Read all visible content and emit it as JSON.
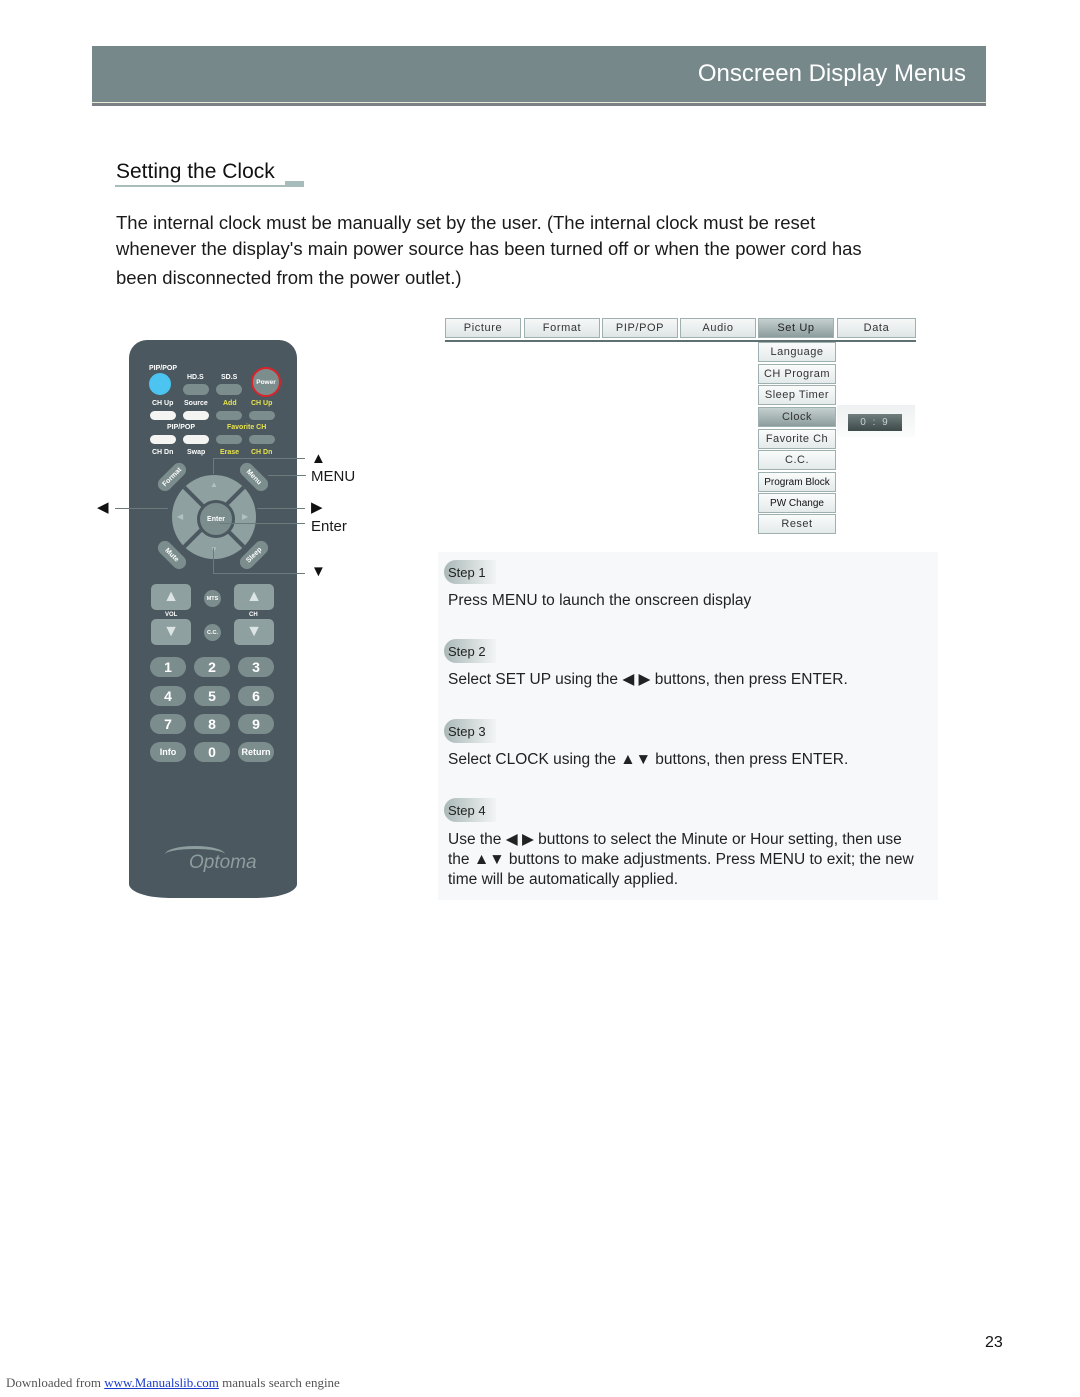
{
  "header": {
    "title": "Onscreen Display Menus"
  },
  "section": {
    "title": "Setting the Clock",
    "intro_lines": [
      "The internal clock must be manually set by the user. (The internal clock must be reset",
      "whenever the display's main power source has been turned off or when the power cord has",
      "been disconnected from the power outlet.)"
    ]
  },
  "remote": {
    "row1_labels": [
      "PIP/POP",
      "HD.S",
      "SD.S"
    ],
    "power_label": "Power",
    "row2_labels": [
      "CH Up",
      "Source",
      "Add",
      "CH Up"
    ],
    "row3_labels": [
      "PIP/POP",
      "Favorite CH"
    ],
    "row4_labels": [
      "CH Dn",
      "Swap",
      "Erase",
      "CH Dn"
    ],
    "diag_buttons": [
      "Format",
      "Menu",
      "Mute",
      "Sleep"
    ],
    "enter_label": "Enter",
    "mts_label": "MTS",
    "cc_label": "C.C.",
    "vol_label": "VOL",
    "ch_label": "CH",
    "keypad": [
      "1",
      "2",
      "3",
      "4",
      "5",
      "6",
      "7",
      "8",
      "9",
      "Info",
      "0",
      "Return"
    ],
    "brand": "Optoma",
    "icons": {
      "up": "▲",
      "down": "▼",
      "left": "◀",
      "right": "▶"
    }
  },
  "callouts": {
    "up_icon": "▲",
    "menu": "MENU",
    "left_icon": "◀",
    "right_icon": "▶",
    "enter": "Enter",
    "down_icon": "▼"
  },
  "osd": {
    "tabs": [
      "Picture",
      "Format",
      "PIP/POP",
      "Audio",
      "Set Up",
      "Data"
    ],
    "active_tab": "Set Up",
    "setup_items": [
      "Language",
      "CH Program",
      "Sleep Timer",
      "Clock",
      "Favorite Ch",
      "C.C.",
      "Program Block",
      "PW Change",
      "Reset"
    ],
    "active_item": "Clock",
    "clock_value": "0 :   9"
  },
  "steps": [
    {
      "badge": "Step 1",
      "text": "Press MENU to launch the onscreen display"
    },
    {
      "badge": "Step 2",
      "text": "Select SET UP using the ◀ ▶ buttons,  then press ENTER."
    },
    {
      "badge": "Step 3",
      "text": "Select CLOCK using the ▲▼ buttons, then press ENTER."
    },
    {
      "badge": "Step 4",
      "text": "Use the ◀ ▶ buttons to select the Minute or Hour setting, then use the ▲▼  buttons to make adjustments. Press MENU to exit; the new time will be automatically applied."
    }
  ],
  "page_number": "23",
  "footer": {
    "prefix": "Downloaded from ",
    "link_text": "www.Manualslib.com",
    "suffix": " manuals search engine"
  }
}
